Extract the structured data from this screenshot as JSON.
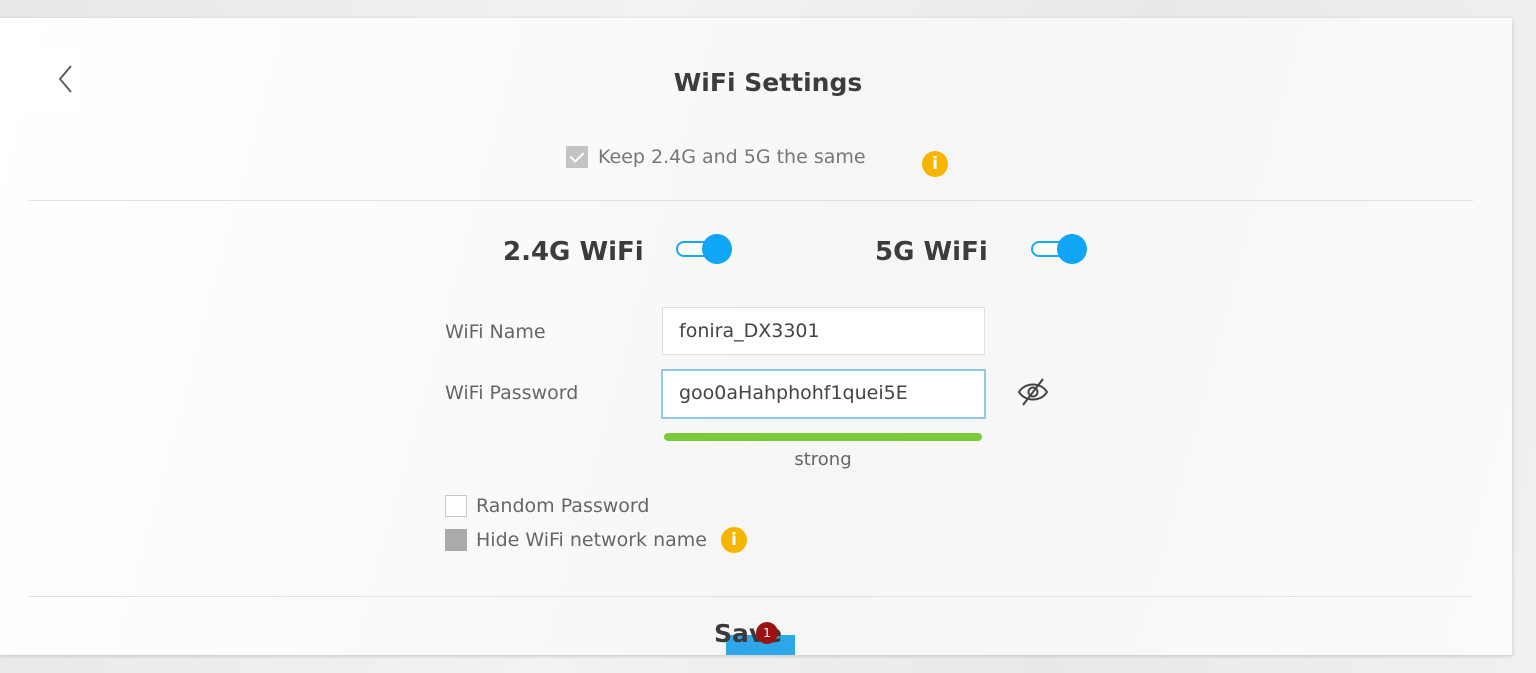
{
  "page": {
    "title": "WiFi Settings"
  },
  "back": {
    "icon": "chevron-left-icon"
  },
  "keep_same": {
    "label": "Keep 2.4G and 5G the same",
    "checked": true,
    "info_icon": "i"
  },
  "bands": [
    {
      "label": "2.4G WiFi",
      "enabled": true
    },
    {
      "label": "5G WiFi",
      "enabled": true
    }
  ],
  "wifi_name": {
    "label": "WiFi Name",
    "value": "fonira_DX3301"
  },
  "wifi_password": {
    "label": "WiFi Password",
    "value": "goo0aHahphohf1quei5E",
    "visibility_icon": "eye-slash-icon"
  },
  "strength": {
    "label": "strong",
    "color": "#7bc93a"
  },
  "options": {
    "random_password": {
      "label": "Random Password",
      "checked": false
    },
    "hide_network": {
      "label": "Hide WiFi network name",
      "checked": true,
      "info_icon": "i"
    }
  },
  "save": {
    "label": "Save",
    "badge": "1"
  },
  "colors": {
    "accent": "#0fa6f5",
    "info": "#f8b500",
    "badge": "#9b1212"
  }
}
